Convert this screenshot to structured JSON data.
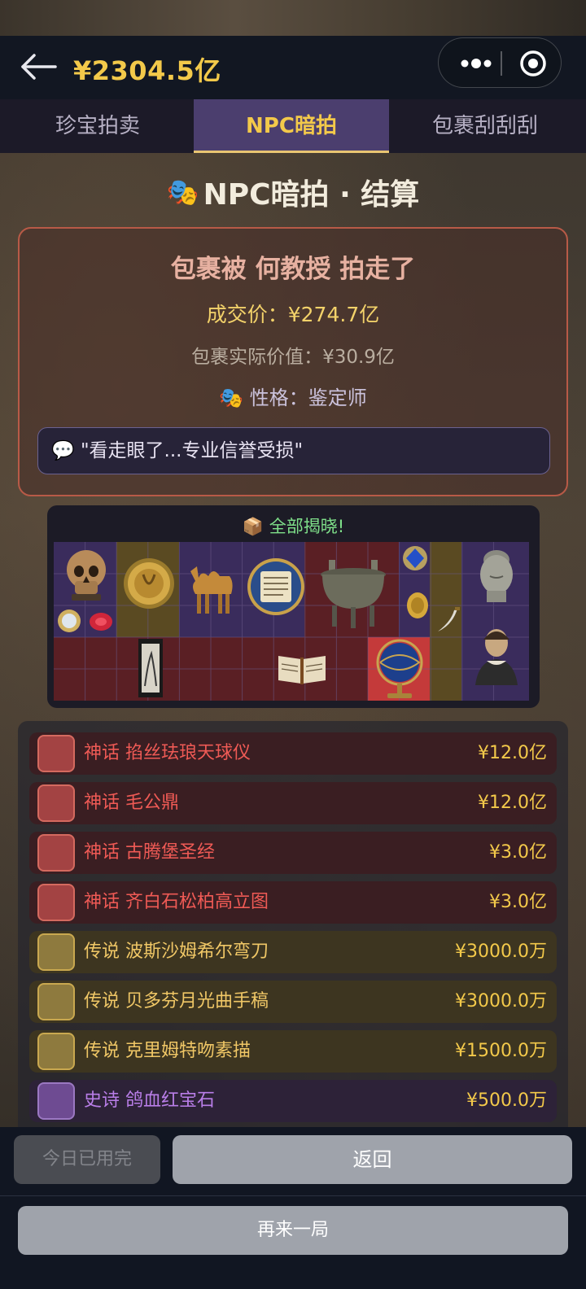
{
  "header": {
    "balance": "¥2304.5亿"
  },
  "tabs": [
    {
      "label": "珍宝拍卖",
      "active": false
    },
    {
      "label": "NPC暗拍",
      "active": true
    },
    {
      "label": "包裹刮刮刮",
      "active": false
    }
  ],
  "page": {
    "title_icon": "🎭",
    "title": "NPC暗拍 · 结算"
  },
  "result": {
    "headline": "包裹被 何教授 拍走了",
    "deal_price": "成交价：¥274.7亿",
    "real_value": "包裹实际价值：¥30.9亿",
    "character_icon": "🎭",
    "character": "性格：鉴定师",
    "quote_icon": "💬",
    "quote": "\"看走眼了...专业信誉受损\""
  },
  "reveal": {
    "icon": "📦",
    "title": "全部揭晓!"
  },
  "items": [
    {
      "rarity": "mythic",
      "label": "神话 掐丝珐琅天球仪",
      "price": "¥12.0亿",
      "icon": "globe-icon"
    },
    {
      "rarity": "mythic",
      "label": "神话 毛公鼎",
      "price": "¥12.0亿",
      "icon": "cauldron-icon"
    },
    {
      "rarity": "mythic",
      "label": "神话 古腾堡圣经",
      "price": "¥3.0亿",
      "icon": "book-icon"
    },
    {
      "rarity": "mythic",
      "label": "神话 齐白石松柏高立图",
      "price": "¥3.0亿",
      "icon": "scroll-painting-icon"
    },
    {
      "rarity": "legend",
      "label": "传说 波斯沙姆希尔弯刀",
      "price": "¥3000.0万",
      "icon": "scimitar-icon"
    },
    {
      "rarity": "legend",
      "label": "传说 贝多芬月光曲手稿",
      "price": "¥3000.0万",
      "icon": "manuscript-icon"
    },
    {
      "rarity": "legend",
      "label": "传说 克里姆特吻素描",
      "price": "¥1500.0万",
      "icon": "gold-medallion-icon"
    },
    {
      "rarity": "epic",
      "label": "史诗 鸽血红宝石",
      "price": "¥500.0万",
      "icon": "ruby-icon"
    }
  ],
  "buttons": {
    "used_today": "今日已用完",
    "back": "返回",
    "again": "再来一局"
  },
  "colors": {
    "gold": "#f3c94a",
    "mythic": "#ef5a55",
    "legend": "#f0c766",
    "epic": "#b97ee8",
    "active_tab": "#4b3e6e"
  }
}
